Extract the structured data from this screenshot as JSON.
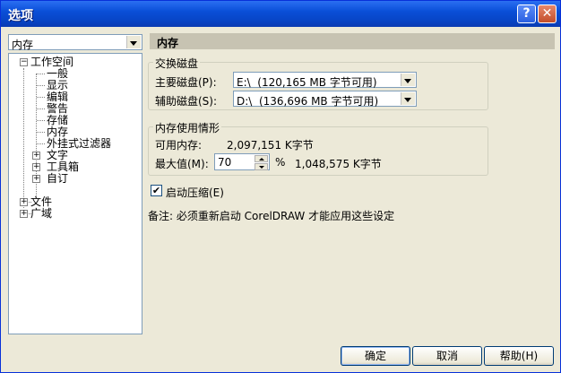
{
  "window": {
    "title": "选项"
  },
  "category_combo": {
    "value": "内存"
  },
  "tree": {
    "root": "工作空间",
    "children": [
      "一般",
      "显示",
      "编辑",
      "警告",
      "存储",
      "内存",
      "外挂式过滤器"
    ],
    "sub": [
      "文字",
      "工具箱",
      "自订"
    ],
    "top": [
      "文件",
      "广域"
    ]
  },
  "header": {
    "title": "内存"
  },
  "swap": {
    "group": "交换磁盘",
    "primary_label": "主要磁盘(P):",
    "primary_value": "E:\\  (120,165 MB 字节可用)",
    "secondary_label": "辅助磁盘(S):",
    "secondary_value": "D:\\  (136,696 MB 字节可用)"
  },
  "memory": {
    "group": "内存使用情形",
    "available_label": "可用内存:",
    "available_value": "2,097,151 K字节",
    "max_label": "最大值(M):",
    "max_value": "70",
    "percent": "%",
    "max_kb": "1,048,575 K字节"
  },
  "compress": {
    "label": "启动压缩(E)",
    "checked": "✔"
  },
  "note": "备注: 必须重新启动 CorelDRAW 才能应用这些设定",
  "buttons": {
    "ok": "确定",
    "cancel": "取消",
    "help": "帮助(H)"
  },
  "titlebar": {
    "help_glyph": "?",
    "close_glyph": "✕"
  },
  "tree_glyphs": {
    "minus": "−",
    "plus": "+"
  }
}
